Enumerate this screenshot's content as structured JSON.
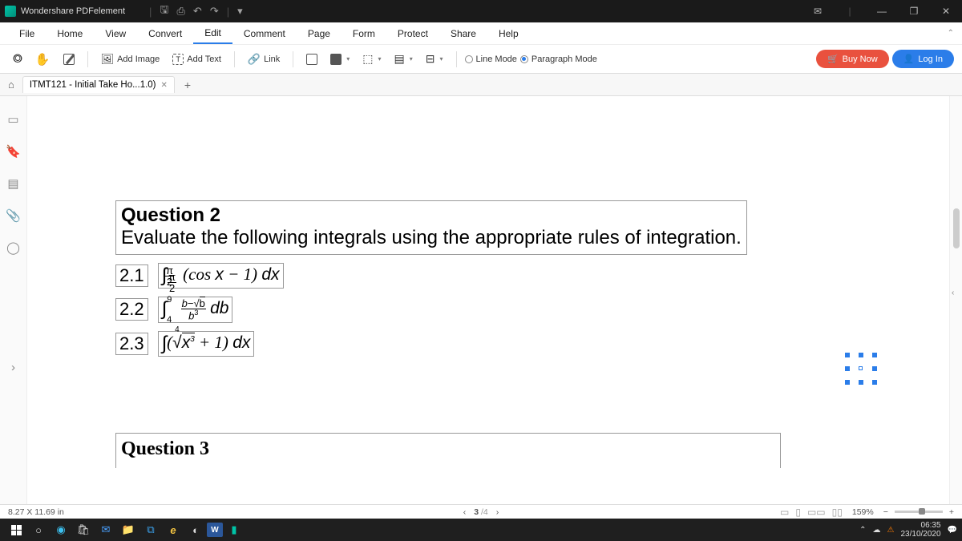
{
  "titlebar": {
    "title": "Wondershare PDFelement"
  },
  "menu": {
    "items": [
      "File",
      "Home",
      "View",
      "Convert",
      "Edit",
      "Comment",
      "Page",
      "Form",
      "Protect",
      "Share",
      "Help"
    ],
    "active": "Edit"
  },
  "toolbar": {
    "add_image": "Add Image",
    "add_text": "Add Text",
    "link": "Link",
    "line_mode": "Line Mode",
    "paragraph_mode": "Paragraph Mode",
    "buy_now": "Buy Now",
    "log_in": "Log In"
  },
  "tab": {
    "label": "ITMT121 - Initial Take Ho...1.0)"
  },
  "doc": {
    "q2_title": "Question 2",
    "q2_prompt": "Evaluate the following integrals using the appropriate rules of integration.",
    "r1_num": "2.1",
    "r2_num": "2.2",
    "r3_num": "2.3",
    "q3_title": "Question 3"
  },
  "status": {
    "dims": "8.27 X 11.69 in",
    "page_cur": "3",
    "page_sep": " /4",
    "zoom": "159%"
  },
  "tray": {
    "time": "06:35",
    "date": "23/10/2020"
  }
}
